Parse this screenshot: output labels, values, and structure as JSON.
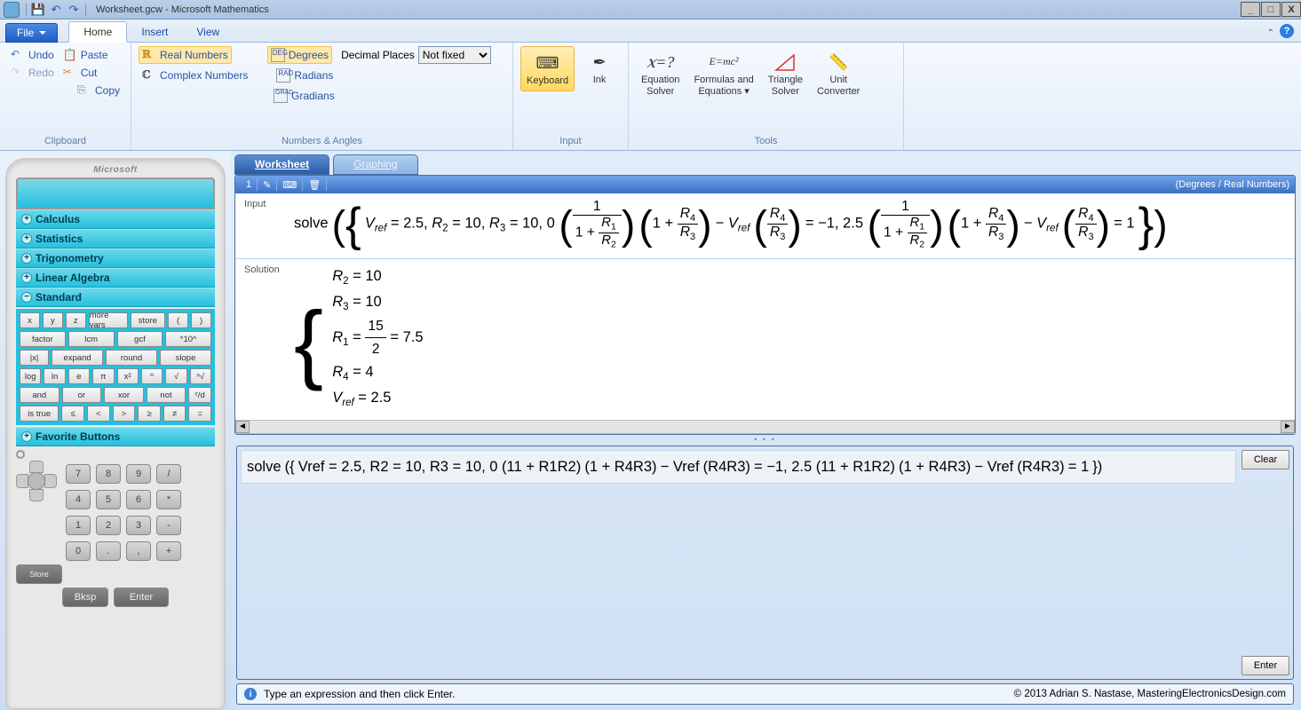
{
  "window": {
    "title": "Worksheet.gcw - Microsoft Mathematics"
  },
  "qat": {
    "save": "save",
    "undo": "undo",
    "redo": "redo"
  },
  "menu": {
    "file": "File",
    "tabs": [
      "Home",
      "Insert",
      "View"
    ],
    "active": 0
  },
  "ribbon": {
    "clipboard": {
      "label": "Clipboard",
      "undo": "Undo",
      "redo": "Redo",
      "paste": "Paste",
      "cut": "Cut",
      "copy": "Copy"
    },
    "numbers": {
      "label": "Numbers & Angles",
      "real": "Real Numbers",
      "complex": "Complex Numbers",
      "degrees": "Degrees",
      "radians": "Radians",
      "gradians": "Gradians",
      "decimal_label": "Decimal Places",
      "decimal_value": "Not fixed"
    },
    "input": {
      "label": "Input",
      "keyboard": "Keyboard",
      "ink": "Ink"
    },
    "tools": {
      "label": "Tools",
      "solver": "Equation\nSolver",
      "formulas": "Formulas and\nEquations ▾",
      "triangle": "Triangle\nSolver",
      "unit": "Unit\nConverter",
      "solver_icon": "𝑥=?",
      "formulas_icon": "E=mc²"
    }
  },
  "calc": {
    "brand": "Microsoft",
    "cats": [
      "Calculus",
      "Statistics",
      "Trigonometry",
      "Linear Algebra",
      "Standard",
      "Favorite Buttons"
    ],
    "open_cat": 4,
    "rows": [
      [
        "x",
        "y",
        "z",
        "more vars",
        "store",
        "(",
        ")"
      ],
      [
        "factor",
        "lcm",
        "gcf",
        "*10^"
      ],
      [
        "|x|",
        "expand",
        "round",
        "slope"
      ],
      [
        "log",
        "ln",
        "e",
        "π",
        "x²",
        "^",
        "√",
        "ⁿ√"
      ],
      [
        "and",
        "or",
        "xor",
        "not",
        "ᶜ/d"
      ],
      [
        "is true",
        "≤",
        "<",
        ">",
        "≥",
        "≠",
        "="
      ]
    ],
    "hard": {
      "row1": [
        "7",
        "8",
        "9",
        "/"
      ],
      "row2": [
        "4",
        "5",
        "6",
        "*"
      ],
      "row3": [
        "1",
        "2",
        "3",
        "-"
      ],
      "row4": [
        "0",
        ".",
        ",",
        "+"
      ],
      "store": "Store",
      "bksp": "Bksp",
      "enter": "Enter"
    }
  },
  "ws": {
    "tabs": [
      "Worksheet",
      "Graphing"
    ],
    "mode": "(Degrees / Real Numbers)",
    "history_index": "1",
    "input_label": "Input",
    "solution_label": "Solution",
    "solution": {
      "l1": "R₂ = 10",
      "l2": "R₃ = 10",
      "l3_lhs": "R₁ = ",
      "l3_num": "15",
      "l3_den": "2",
      "l3_rhs": " = 7.5",
      "l4": "R₄ = 4",
      "l5_lhs": "V",
      "l5_sub": "ref",
      "l5_rhs": " = 2.5"
    },
    "clear": "Clear",
    "enter": "Enter",
    "hint": "Type an expression and then click Enter.",
    "copyright": "© 2013 Adrian S. Nastase, MasteringElectronicsDesign.com"
  },
  "expr": {
    "solve": "solve",
    "vref": "V",
    "ref": "ref",
    "eq25": " = 2.5, ",
    "r2": "R",
    "s2": "2",
    "eq10a": " = 10, ",
    "r3": "R",
    "s3": "3",
    "eq10b": " = 10, 0 ",
    "one": "1",
    "oneplus": "1 + ",
    "r1": "R",
    "s1": "1",
    "r4": "R",
    "s4": "4",
    "minus": " − ",
    "eqm1": " = −1, 2.5 ",
    "eq1": " = 1"
  }
}
